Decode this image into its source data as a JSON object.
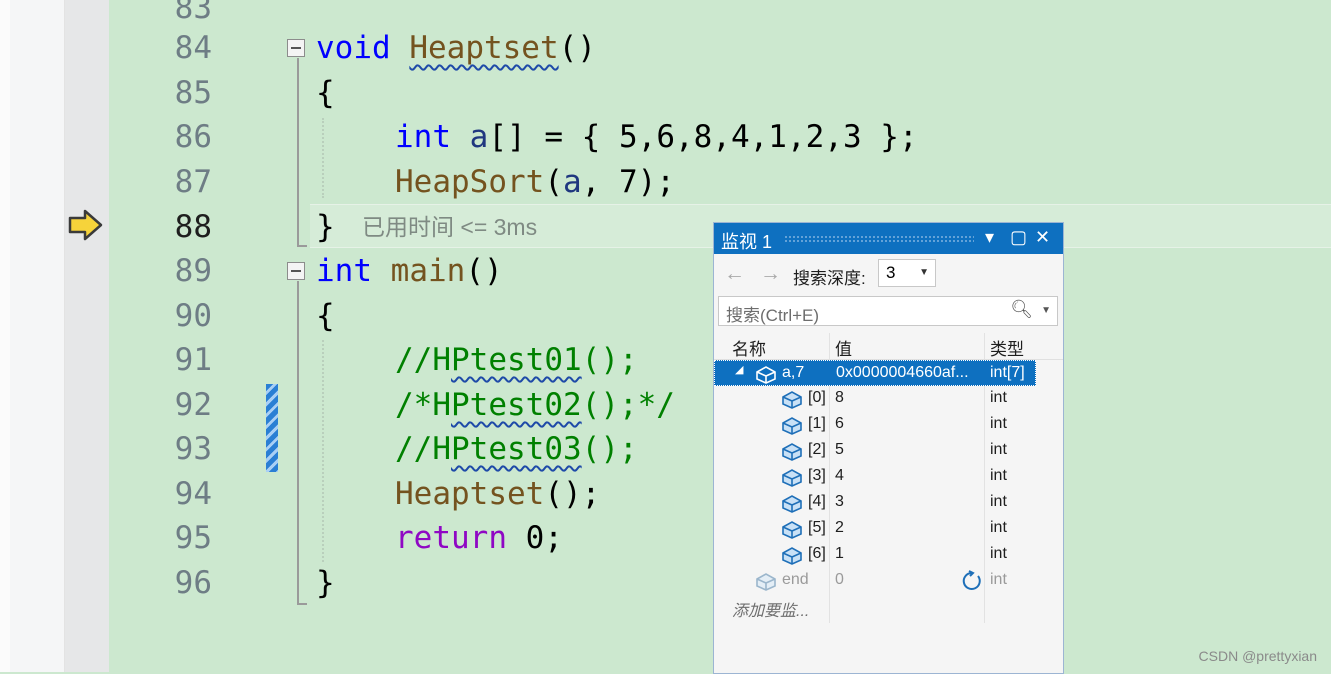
{
  "editor": {
    "lines": [
      {
        "n": "83"
      },
      {
        "n": "84"
      },
      {
        "n": "85"
      },
      {
        "n": "86"
      },
      {
        "n": "87"
      },
      {
        "n": "88"
      },
      {
        "n": "89"
      },
      {
        "n": "90"
      },
      {
        "n": "91"
      },
      {
        "n": "92"
      },
      {
        "n": "93"
      },
      {
        "n": "94"
      },
      {
        "n": "95"
      },
      {
        "n": "96"
      }
    ],
    "code": {
      "l84_kw": "void",
      "l84_fn": "Heaptset",
      "l84_rest": "()",
      "l85": "{",
      "l86_kw": "int",
      "l86_var": "a",
      "l86_rest": "[] = { 5,6,8,4,1,2,3 };",
      "l87_fn": "HeapSort",
      "l87_open": "(",
      "l87_var": "a",
      "l87_rest": ", 7);",
      "l88": "}",
      "l89_kw": "int",
      "l89_fn": "main",
      "l89_rest": "()",
      "l90": "{",
      "l91_a": "//H",
      "l91_b": "Ptest01",
      "l91_c": "();",
      "l92_a": "/*H",
      "l92_b": "Ptest02",
      "l92_c": "();*/",
      "l93_a": "//H",
      "l93_b": "Ptest03",
      "l93_c": "();",
      "l94_fn": "Heaptset",
      "l94_rest": "();",
      "l95_kw": "return",
      "l95_rest": " 0;",
      "l96": "}"
    },
    "elapsed": "已用时间 <= 3ms"
  },
  "watch": {
    "title": "监视 1",
    "depth_label": "搜索深度:",
    "depth_value": "3",
    "search_placeholder": "搜索(Ctrl+E)",
    "columns": {
      "name": "名称",
      "value": "值",
      "type": "类型"
    },
    "root": {
      "name": "a,7",
      "value": "0x0000004660af...",
      "type": "int[7]"
    },
    "items": [
      {
        "name": "[0]",
        "value": "8",
        "type": "int"
      },
      {
        "name": "[1]",
        "value": "6",
        "type": "int"
      },
      {
        "name": "[2]",
        "value": "5",
        "type": "int"
      },
      {
        "name": "[3]",
        "value": "4",
        "type": "int"
      },
      {
        "name": "[4]",
        "value": "3",
        "type": "int"
      },
      {
        "name": "[5]",
        "value": "2",
        "type": "int"
      },
      {
        "name": "[6]",
        "value": "1",
        "type": "int"
      }
    ],
    "stale": {
      "name": "end",
      "value": "0",
      "type": "int"
    },
    "add_placeholder": "添加要监..."
  },
  "watermark": "CSDN @prettyxian",
  "icons": [
    "execution-arrow-icon",
    "collapse-icon",
    "variable-cube-icon",
    "refresh-icon",
    "search-icon"
  ],
  "colors": {
    "editor_bg": "#cce8cf",
    "keyword": "#0000ff",
    "function": "#74531f",
    "comment": "#008000",
    "accent": "#0e70c0"
  }
}
